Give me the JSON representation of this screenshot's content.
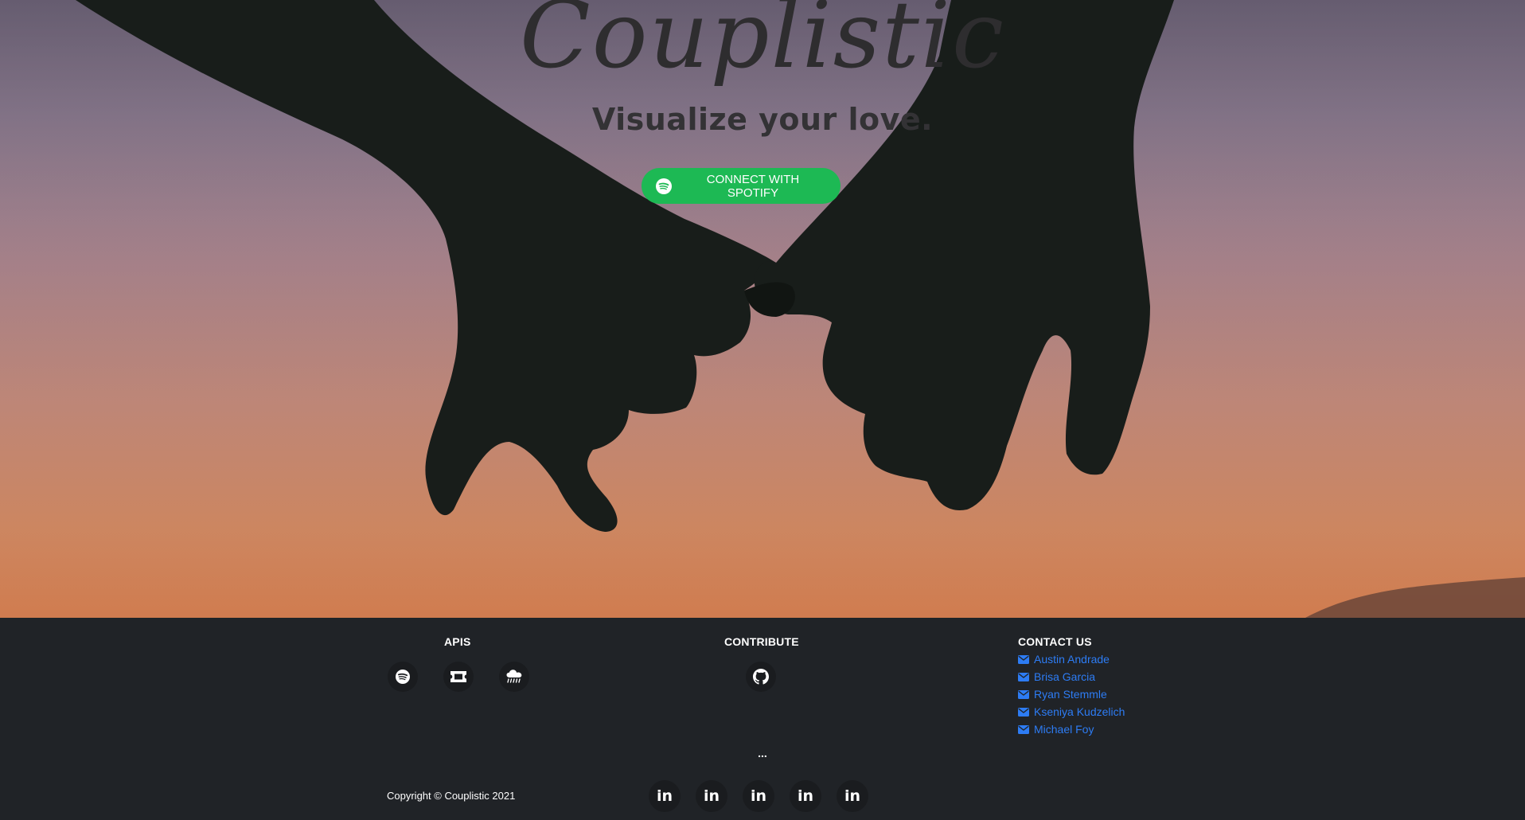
{
  "hero": {
    "brand": "Couplistic",
    "tagline": "Visualize your love.",
    "connect_button": "CONNECT WITH SPOTIFY",
    "connect_icon": "spotify-icon",
    "background_description_colors": {
      "sky_top": "#6f6477",
      "sky_bottom": "#d07c4f",
      "silhouette": "#181d1a"
    }
  },
  "footer": {
    "apis": {
      "title": "APIS",
      "icons": [
        "spotify-icon",
        "ticket-icon",
        "cloud-rain-icon"
      ]
    },
    "contribute": {
      "title": "CONTRIBUTE",
      "icons": [
        "github-icon"
      ]
    },
    "contact": {
      "title": "CONTACT US",
      "people": [
        "Austin Andrade",
        "Brisa Garcia",
        "Ryan Stemmle",
        "Kseniya Kudzelich",
        "Michael Foy"
      ],
      "icon": "envelope-icon",
      "link_color": "#2d7cf4"
    },
    "ellipsis": "...",
    "copyright": "Copyright © Couplistic 2021",
    "social": {
      "label": "in",
      "icons": [
        "linkedin-icon",
        "linkedin-icon",
        "linkedin-icon",
        "linkedin-icon",
        "linkedin-icon"
      ]
    }
  },
  "colors": {
    "spotify_green": "#1db954",
    "footer_bg": "#202327",
    "icon_circle_bg": "#1a1c1f"
  }
}
